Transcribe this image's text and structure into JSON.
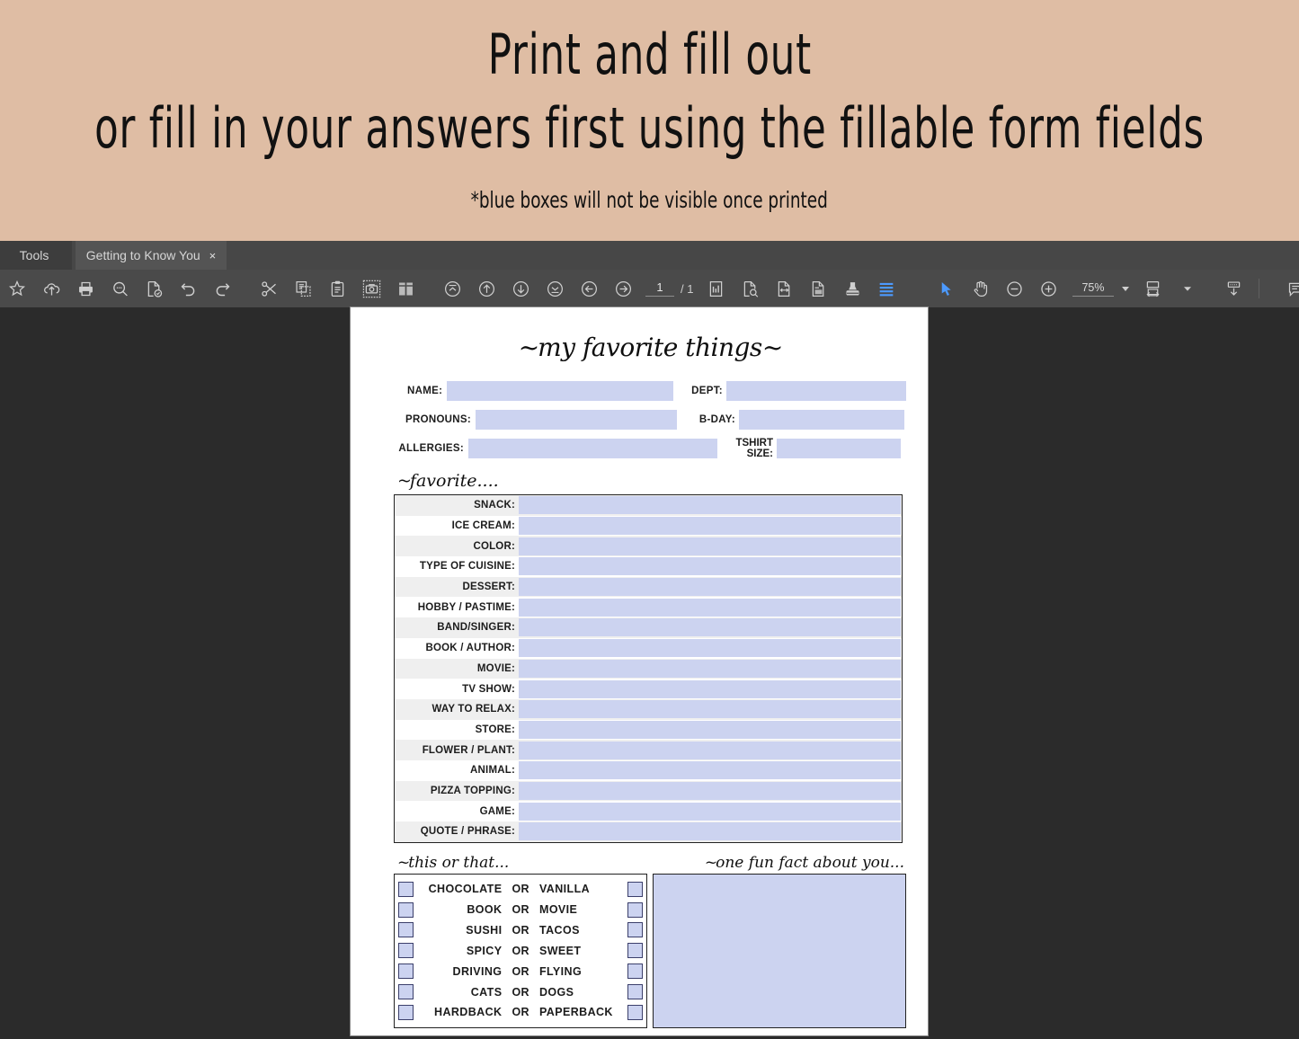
{
  "banner": {
    "line1": "Print and fill out",
    "line2": "or fill in your answers first using the fillable form fields",
    "note": "*blue boxes will not be visible once printed",
    "bg_color": "#dfbda4"
  },
  "tabs": {
    "tools_label": "Tools",
    "document_tab_label": "Getting to Know You",
    "close_glyph": "×"
  },
  "toolbar": {
    "page_current": "1",
    "page_separator": "/ 1",
    "zoom_level": "75%",
    "accent_color": "#4c9aff",
    "icons": [
      "star-icon",
      "cloud-upload-icon",
      "print-icon",
      "search-icon",
      "certify-document-icon",
      "undo-icon",
      "redo-icon",
      "scissors-icon",
      "copy-icon",
      "clipboard-paste-icon",
      "snapshot-camera-icon",
      "compare-files-icon",
      "first-page-icon",
      "previous-page-icon",
      "next-page-icon",
      "last-page-icon",
      "page-back-icon",
      "page-forward-icon",
      "page-thumbnails-icon",
      "find-in-document-icon",
      "fit-width-icon",
      "extract-pages-icon",
      "stamp-icon",
      "highlight-icon",
      "select-tool-icon",
      "hand-tool-icon",
      "zoom-out-icon",
      "zoom-in-icon",
      "page-fit-icon",
      "scroll-mode-icon",
      "comment-icon"
    ]
  },
  "document": {
    "title": "my favorite things",
    "identity": [
      {
        "label": "NAME:",
        "label2": "DEPT:"
      },
      {
        "label": "PRONOUNS:",
        "label2": "B-DAY:"
      },
      {
        "label": "ALLERGIES:",
        "label2": "TSHIRT SIZE:"
      }
    ],
    "favorite_heading": "favorite....",
    "favorite_rows": [
      "SNACK:",
      "ICE CREAM:",
      "COLOR:",
      "TYPE OF CUISINE:",
      "DESSERT:",
      "HOBBY / PASTIME:",
      "BAND/SINGER:",
      "BOOK / AUTHOR:",
      "MOVIE:",
      "TV SHOW:",
      "WAY TO RELAX:",
      "STORE:",
      "FLOWER / PLANT:",
      "ANIMAL:",
      "PIZZA TOPPING:",
      "GAME:",
      "QUOTE / PHRASE:"
    ],
    "this_or_that_heading": "this or that...",
    "fun_fact_heading": "one fun fact about you...",
    "this_or_that_rows": [
      {
        "a": "CHOCOLATE",
        "or": "OR",
        "b": "VANILLA"
      },
      {
        "a": "BOOK",
        "or": "OR",
        "b": "MOVIE"
      },
      {
        "a": "SUSHI",
        "or": "OR",
        "b": "TACOS"
      },
      {
        "a": "SPICY",
        "or": "OR",
        "b": "SWEET"
      },
      {
        "a": "DRIVING",
        "or": "OR",
        "b": "FLYING"
      },
      {
        "a": "CATS",
        "or": "OR",
        "b": "DOGS"
      },
      {
        "a": "HARDBACK",
        "or": "OR",
        "b": "PAPERBACK"
      }
    ],
    "field_fill_color": "#ccd3f0",
    "row_alt_color": "#efefef"
  }
}
